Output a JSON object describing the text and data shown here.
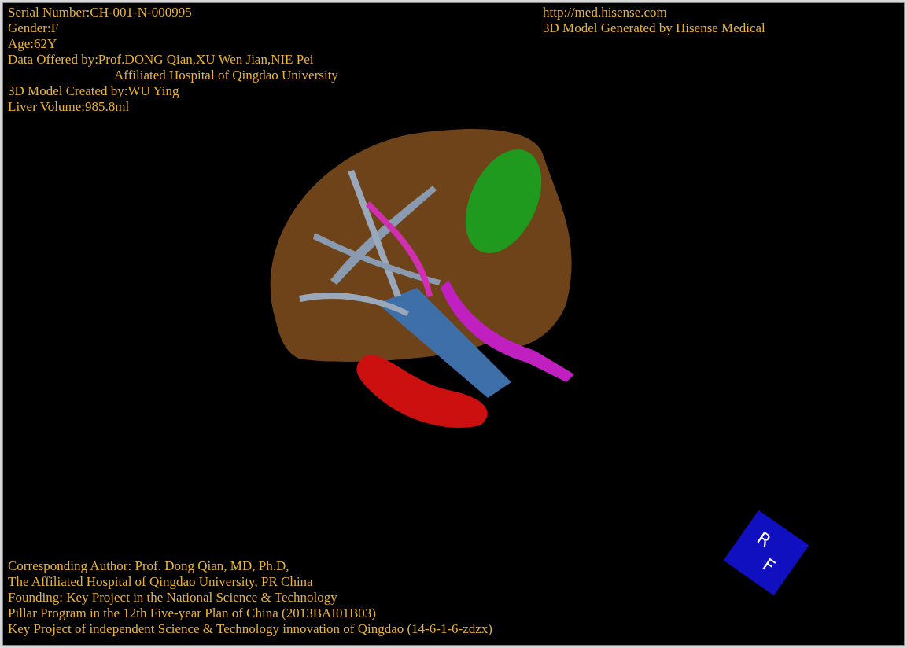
{
  "patient_info": [
    "Serial Number:CH-001-N-000995",
    "Gender:F",
    "Age:62Y",
    "Data Offered by:Prof.DONG Qian,XU Wen Jian,NIE Pei",
    "Affiliated Hospital of Qingdao University",
    "3D Model Created by:WU Ying",
    "Liver Volume:985.8ml"
  ],
  "producer_info": [
    "http://med.hisense.com",
    "3D Model Generated by Hisense Medical"
  ],
  "credits": [
    "Corresponding Author: Prof. Dong Qian, MD, Ph.D,",
    "The Affiliated Hospital of Qingdao University, PR China",
    "Founding: Key Project in the National Science & Technology",
    "Pillar Program in the 12th Five-year Plan of China (2013BAI01B03)",
    "Key Project of independent Science & Technology innovation of Qingdao (14-6-1-6-zdzx)"
  ],
  "orientation_cube": {
    "faces": [
      "R",
      "F"
    ]
  }
}
